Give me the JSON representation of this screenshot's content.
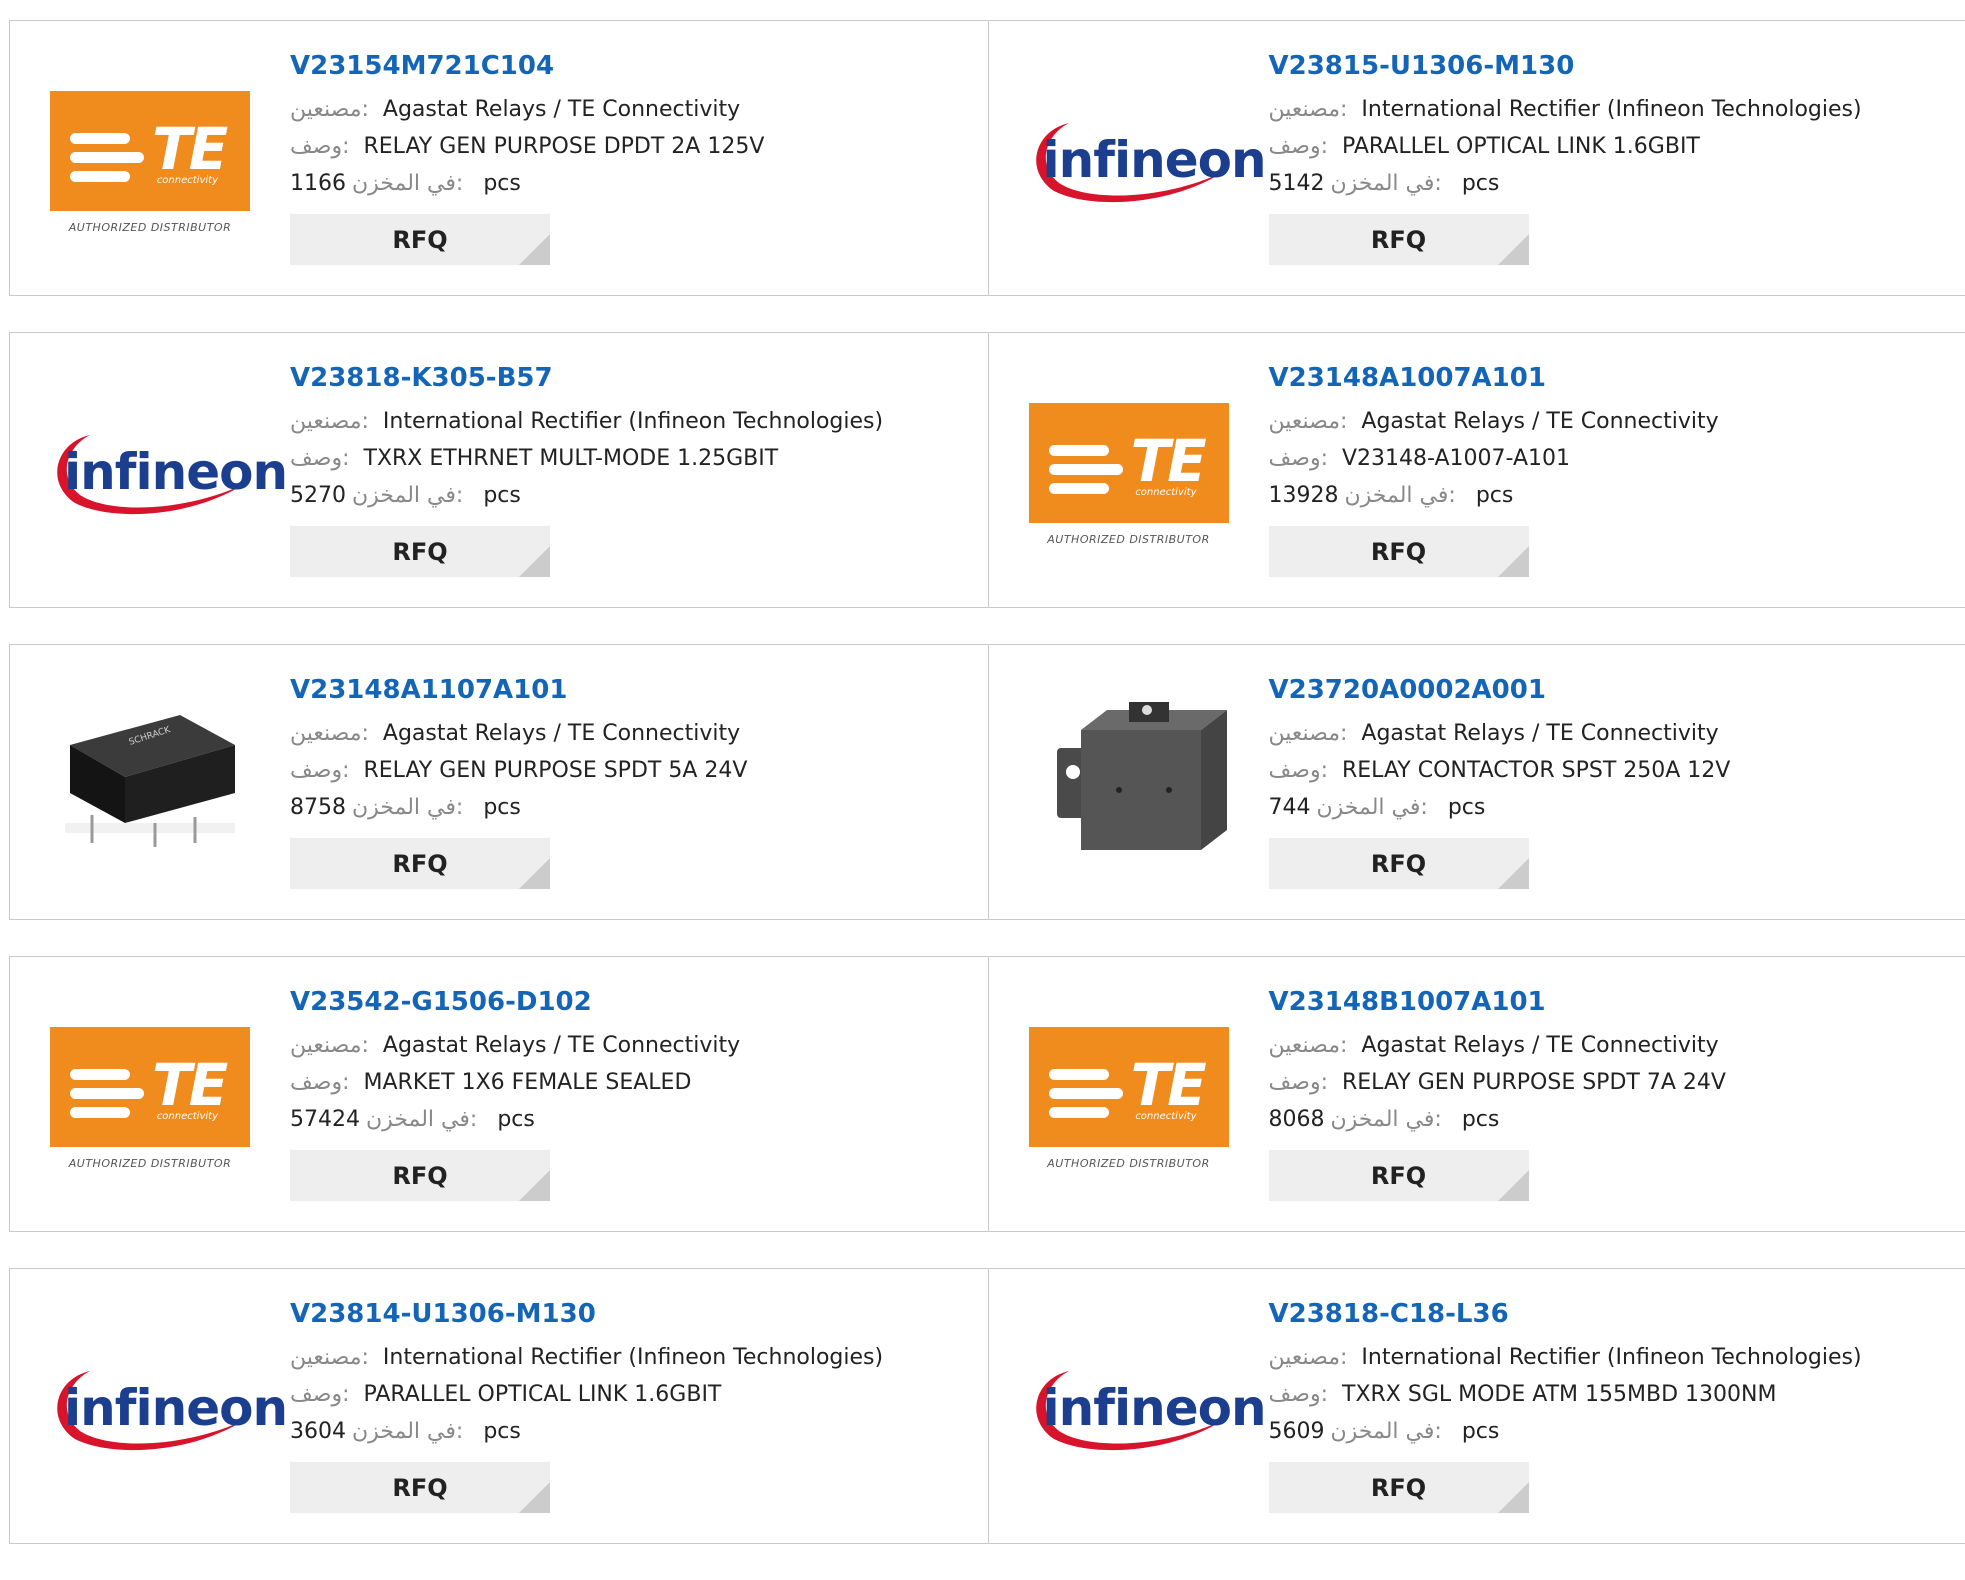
{
  "labels": {
    "manufacturer": "مصنعين:",
    "description": "وصف:",
    "stock": "في المخزن:",
    "pcs": "pcs",
    "rfq": "RFQ"
  },
  "logos": {
    "te": {
      "brand": "TE",
      "tagline": "connectivity",
      "badge": "AUTHORIZED DISTRIBUTOR",
      "color": "#f08b1d"
    },
    "infineon": {
      "brand": "infineon",
      "color": "#1b3f8e",
      "swoosh_color": "#d7142b"
    }
  },
  "products": [
    {
      "part": "V23154M721C104",
      "manufacturer": "Agastat Relays / TE Connectivity",
      "description": "RELAY GEN PURPOSE DPDT 2A 125V",
      "stock": "1166",
      "logo": "te-logo"
    },
    {
      "part": "V23815-U1306-M130",
      "manufacturer": "International Rectifier (Infineon Technologies)",
      "description": "PARALLEL OPTICAL LINK 1.6GBIT",
      "stock": "5142",
      "logo": "infineon-logo"
    },
    {
      "part": "V23818-K305-B57",
      "manufacturer": "International Rectifier (Infineon Technologies)",
      "description": "TXRX ETHRNET MULT-MODE 1.25GBIT",
      "stock": "5270",
      "logo": "infineon-logo"
    },
    {
      "part": "V23148A1007A101",
      "manufacturer": "Agastat Relays / TE Connectivity",
      "description": "V23148-A1007-A101",
      "stock": "13928",
      "logo": "te-logo"
    },
    {
      "part": "V23148A1107A101",
      "manufacturer": "Agastat Relays / TE Connectivity",
      "description": "RELAY GEN PURPOSE SPDT 5A 24V",
      "stock": "8758",
      "logo": "relay-photo"
    },
    {
      "part": "V23720A0002A001",
      "manufacturer": "Agastat Relays / TE Connectivity",
      "description": "RELAY CONTACTOR SPST 250A 12V",
      "stock": "744",
      "logo": "contactor-photo"
    },
    {
      "part": "V23542-G1506-D102",
      "manufacturer": "Agastat Relays / TE Connectivity",
      "description": "MARKET 1X6 FEMALE SEALED",
      "stock": "57424",
      "logo": "te-logo"
    },
    {
      "part": "V23148B1007A101",
      "manufacturer": "Agastat Relays / TE Connectivity",
      "description": "RELAY GEN PURPOSE SPDT 7A 24V",
      "stock": "8068",
      "logo": "te-logo"
    },
    {
      "part": "V23814-U1306-M130",
      "manufacturer": "International Rectifier (Infineon Technologies)",
      "description": "PARALLEL OPTICAL LINK 1.6GBIT",
      "stock": "3604",
      "logo": "infineon-logo"
    },
    {
      "part": "V23818-C18-L36",
      "manufacturer": "International Rectifier (Infineon Technologies)",
      "description": "TXRX SGL MODE ATM 155MBD 1300NM",
      "stock": "5609",
      "logo": "infineon-logo"
    }
  ]
}
